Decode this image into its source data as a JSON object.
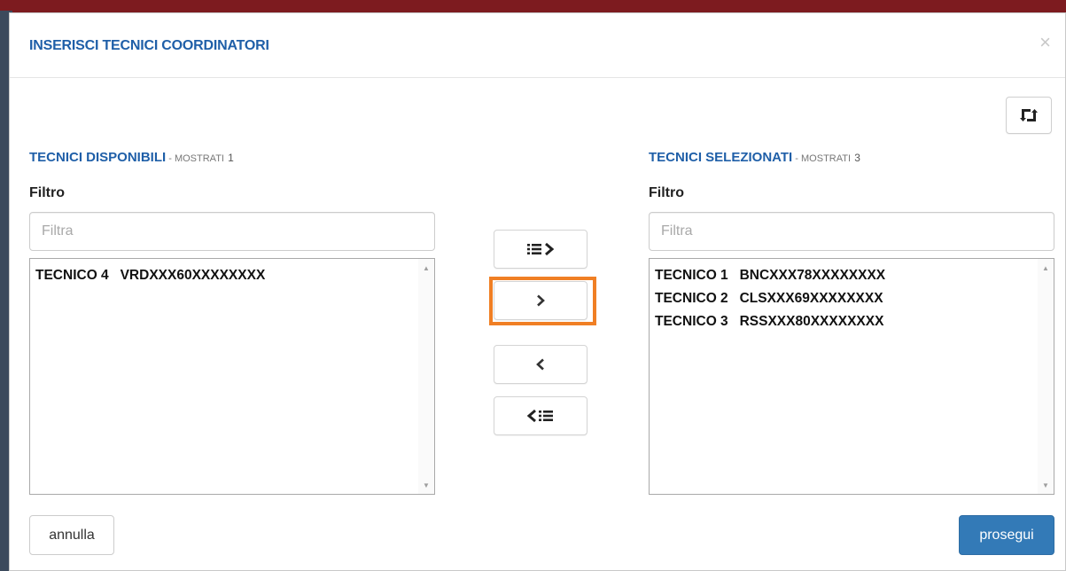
{
  "modal": {
    "title": "INSERISCI TECNICI COORDINATORI",
    "close_label": "×"
  },
  "left_panel": {
    "heading": "TECNICI DISPONIBILI",
    "sub_label": " - MOSTRATI",
    "count": "1",
    "filter_label": "Filtro",
    "filter_placeholder": "Filtra",
    "filter_value": "",
    "items": [
      "TECNICO 4   VRDXXX60XXXXXXXX"
    ]
  },
  "right_panel": {
    "heading": "TECNICI SELEZIONATI",
    "sub_label": " - MOSTRATI",
    "count": "3",
    "filter_label": "Filtro",
    "filter_placeholder": "Filtra",
    "filter_value": "",
    "items": [
      "TECNICO 1   BNCXXX78XXXXXXXX",
      "TECNICO 2   CLSXXX69XXXXXXXX",
      "TECNICO 3   RSSXXX80XXXXXXXX"
    ]
  },
  "transfer_buttons": {
    "icons": [
      "move-all-right-icon",
      "move-right-icon",
      "move-left-icon",
      "move-all-left-icon"
    ],
    "highlighted": "move-right",
    "highlight_color": "#f07f24"
  },
  "footer": {
    "cancel_label": "annulla",
    "continue_label": "prosegui"
  },
  "colors": {
    "title_blue": "#1f5fa8",
    "primary_button": "#337ab7"
  }
}
